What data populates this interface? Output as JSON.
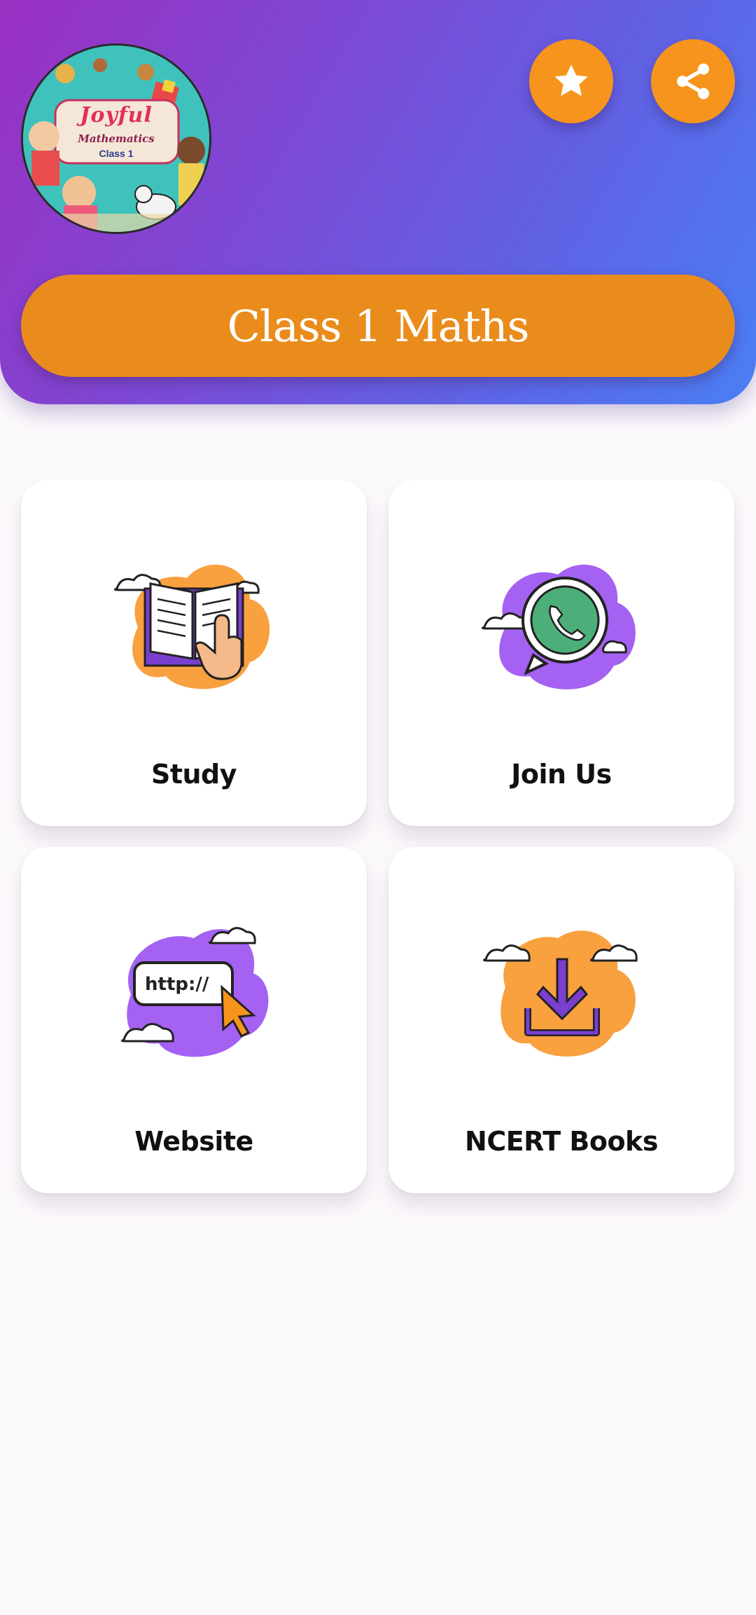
{
  "app": {
    "title": "Class 1 Maths"
  },
  "logo": {
    "title": "Joyful",
    "subtitle": "Mathematics",
    "class_label": "Class 1"
  },
  "header": {
    "favorite_icon": "star-icon",
    "share_icon": "share-icon",
    "accent_color": "#f7941d"
  },
  "menu": {
    "items": [
      {
        "label": "Study",
        "icon": "open-book-icon",
        "blob_color": "#f9a03f"
      },
      {
        "label": "Join Us",
        "icon": "whatsapp-icon",
        "blob_color": "#a461f2"
      },
      {
        "label": "Website",
        "icon": "http-link-icon",
        "blob_color": "#a461f2"
      },
      {
        "label": "NCERT Books",
        "icon": "download-icon",
        "blob_color": "#f9a03f"
      }
    ]
  }
}
